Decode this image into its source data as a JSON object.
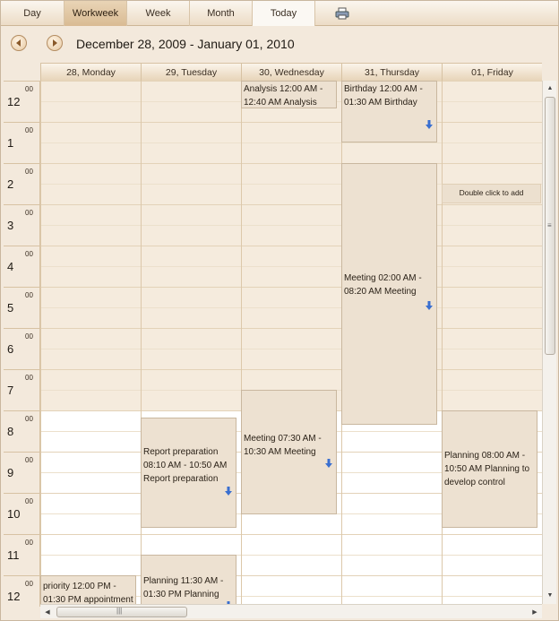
{
  "toolbar": {
    "buttons": [
      {
        "label": "Day"
      },
      {
        "label": "Workweek",
        "active": true
      },
      {
        "label": "Week"
      },
      {
        "label": "Month"
      },
      {
        "label": "Today"
      }
    ],
    "print_icon": "printer-icon"
  },
  "nav": {
    "prev_icon": "prev-arrow-icon",
    "next_icon": "next-arrow-icon",
    "title": "December 28, 2009 - January 01, 2010"
  },
  "columns": [
    "28, Monday",
    "29, Tuesday",
    "30, Wednesday",
    "31, Thursday",
    "01, Friday"
  ],
  "hours": [
    "12",
    "1",
    "2",
    "3",
    "4",
    "5",
    "6",
    "7",
    "8",
    "9",
    "10",
    "11",
    "12"
  ],
  "minute_label": "00",
  "appointments": [
    {
      "day": 2,
      "text": "Analysis 12:00 AM - 12:40 AM Analysis",
      "arrow": false
    },
    {
      "day": 3,
      "text": "Birthday 12:00 AM - 01:30 AM Birthday",
      "arrow": true
    },
    {
      "day": 3,
      "text": "Meeting 02:00 AM - 08:20 AM Meeting",
      "arrow": true
    },
    {
      "day": 2,
      "text": "Meeting 07:30 AM - 10:30 AM Meeting",
      "arrow": true
    },
    {
      "day": 1,
      "text": "Report preparation 08:10 AM - 10:50 AM Report preparation",
      "arrow": true
    },
    {
      "day": 4,
      "text": "Planning 08:00 AM - 10:50 AM Planning to develop control",
      "arrow": false
    },
    {
      "day": 1,
      "text": "Planning 11:30 AM - 01:30 PM Planning",
      "arrow": true
    },
    {
      "day": 0,
      "text": "priority 12:00 PM - 01:30 PM appointment",
      "arrow": false
    }
  ],
  "double_click_hint": "Double click to add",
  "colors": {
    "nonwork_bg": "#f5ebdd",
    "work_bg": "#ffffff",
    "appointment_bg": "#ede1d1",
    "active_tab": "#d9bb93"
  }
}
